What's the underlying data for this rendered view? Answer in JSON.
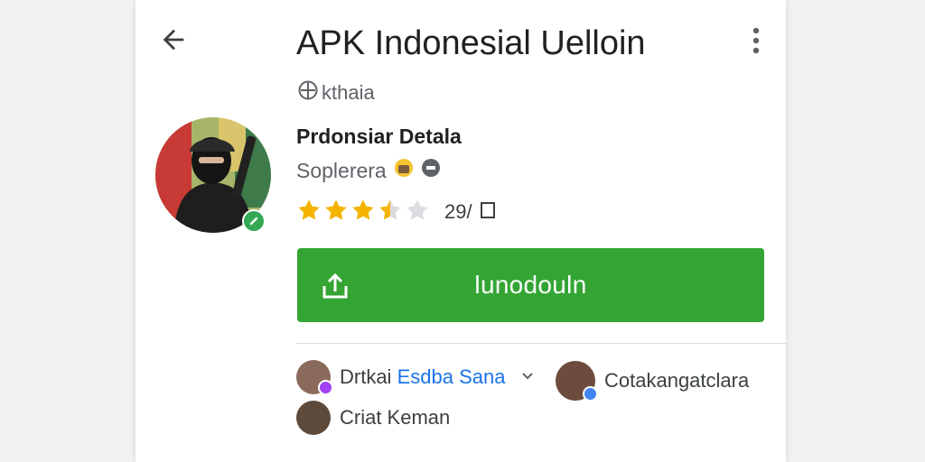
{
  "header": {
    "title": "APK Indonesial Uelloin",
    "subtitle_icon": "globe-icon",
    "subtitle": "kthaia",
    "back_icon": "arrow-left-icon",
    "menu_icon": "more-vert-icon"
  },
  "app": {
    "developer": "Prdonsiar Detala",
    "category": "Soplerera",
    "category_icons": [
      "emoji-icon",
      "badge-icon"
    ],
    "rating": 3.5,
    "rating_max": 5,
    "rating_count": "29/",
    "rating_extra_icon": "square-outline-icon",
    "verified_icon": "check-badge-icon"
  },
  "install": {
    "label": "lunodouln",
    "icon": "upload-icon"
  },
  "people": [
    {
      "prefix": "Drtkai",
      "name": "Esdba Sana",
      "has_dropdown": true,
      "badge_color": "#a142f4"
    },
    {
      "prefix": "Cotakangatclara",
      "name": "",
      "has_dropdown": false,
      "badge_color": "#4285f4"
    },
    {
      "prefix": "Criat Keman",
      "name": "",
      "has_dropdown": false,
      "badge_color": ""
    }
  ],
  "colors": {
    "install_green": "#34a534",
    "verified_green": "#34a853",
    "star_gold": "#f4b400",
    "star_grey": "#dadce0",
    "link_blue": "#1a73e8"
  }
}
